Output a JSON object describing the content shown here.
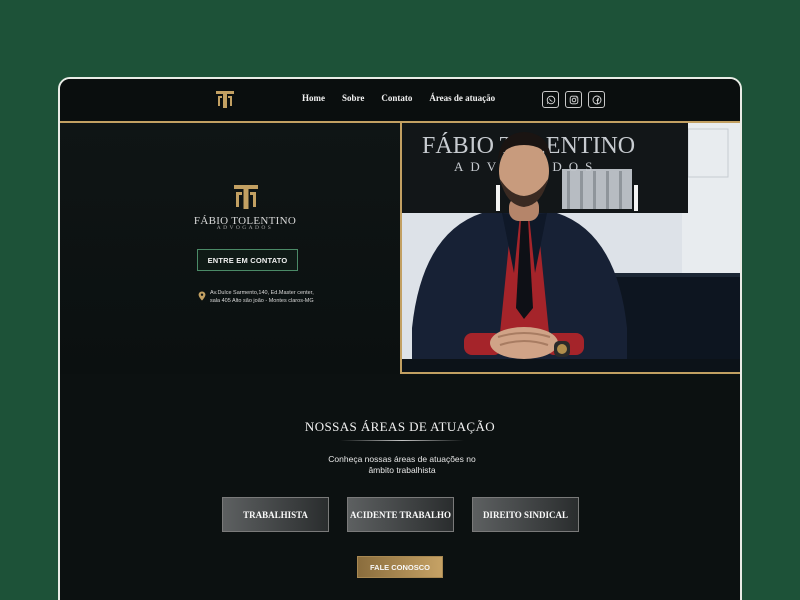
{
  "nav": {
    "links": [
      "Home",
      "Sobre",
      "Contato",
      "Áreas de atuação"
    ],
    "socials": [
      "whatsapp-icon",
      "instagram-icon",
      "facebook-icon"
    ]
  },
  "hero": {
    "firm_name": "FÁBIO TOLENTINO",
    "firm_sub": "ADVOGADOS",
    "contact_button": "ENTRE EM CONTATO",
    "address_line1": "Av.Dulce Sarmento,140, Ed.Master center,",
    "address_line2": "sala 405 Alto são joão - Montes claros-MG",
    "photo_sign_line1": "FÁBIO TOLENTINO",
    "photo_sign_line2": "ADVOGADOS"
  },
  "areas": {
    "title": "NOSSAS ÁREAS DE ATUAÇÃO",
    "subtitle_line1": "Conheça nossas áreas de atuações no",
    "subtitle_line2": "âmbito trabalhista",
    "items": [
      "TRABALHISTA",
      "ACIDENTE TRABALHO",
      "DIREITO SINDICAL"
    ],
    "cta": "FALE CONOSCO"
  },
  "colors": {
    "background": "#1d5238",
    "panel": "#0c1111",
    "gold": "#c2a062",
    "green_accent": "#4b8a67"
  }
}
